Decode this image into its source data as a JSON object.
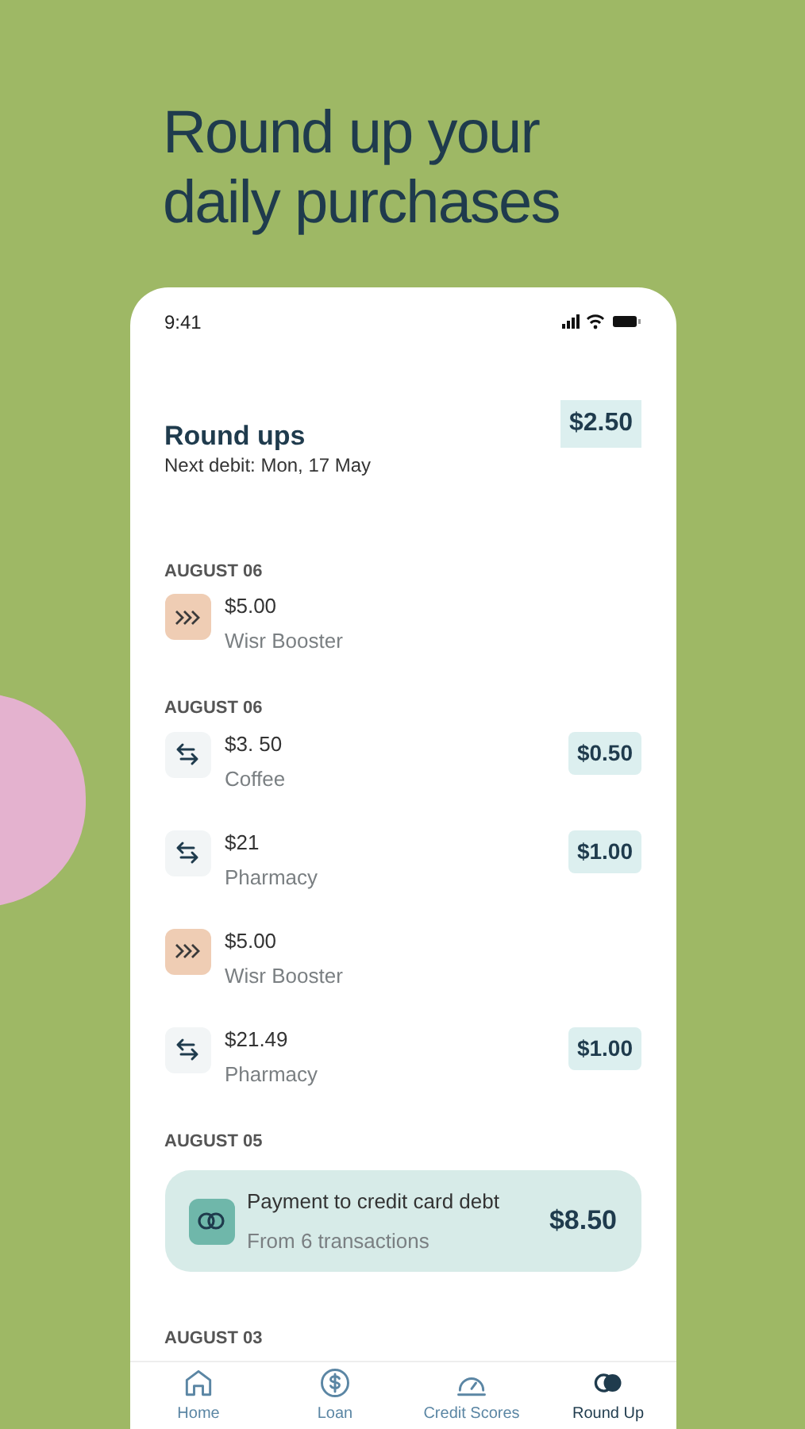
{
  "headline": "Round up your daily purchases",
  "status_bar": {
    "time": "9:41"
  },
  "header": {
    "title": "Round ups",
    "total": "$2.50",
    "next_debit": "Next debit: Mon, 17 May"
  },
  "groups": [
    {
      "date": "AUGUST 06",
      "items": [
        {
          "kind": "booster",
          "amount": "$5.00",
          "merchant": "Wisr Booster"
        }
      ]
    },
    {
      "date": "AUGUST 06",
      "items": [
        {
          "kind": "transfer",
          "amount": "$3. 50",
          "merchant": "Coffee",
          "roundup": "$0.50"
        },
        {
          "kind": "transfer",
          "amount": "$21",
          "merchant": "Pharmacy",
          "roundup": "$1.00"
        },
        {
          "kind": "booster",
          "amount": "$5.00",
          "merchant": "Wisr Booster"
        },
        {
          "kind": "transfer",
          "amount": "$21.49",
          "merchant": "Pharmacy",
          "roundup": "$1.00"
        }
      ]
    },
    {
      "date": "AUGUST 05",
      "items": [
        {
          "kind": "payment",
          "title": "Payment to credit card debt",
          "subtitle": "From 6 transactions",
          "amount": "$8.50"
        }
      ]
    },
    {
      "date": "AUGUST 03"
    }
  ],
  "nav": [
    {
      "kind": "home",
      "label": "Home",
      "selected": false
    },
    {
      "kind": "loan",
      "label": "Loan",
      "selected": false
    },
    {
      "kind": "scores",
      "label": "Credit Scores",
      "selected": false
    },
    {
      "kind": "roundup",
      "label": "Round Up",
      "selected": true
    }
  ]
}
